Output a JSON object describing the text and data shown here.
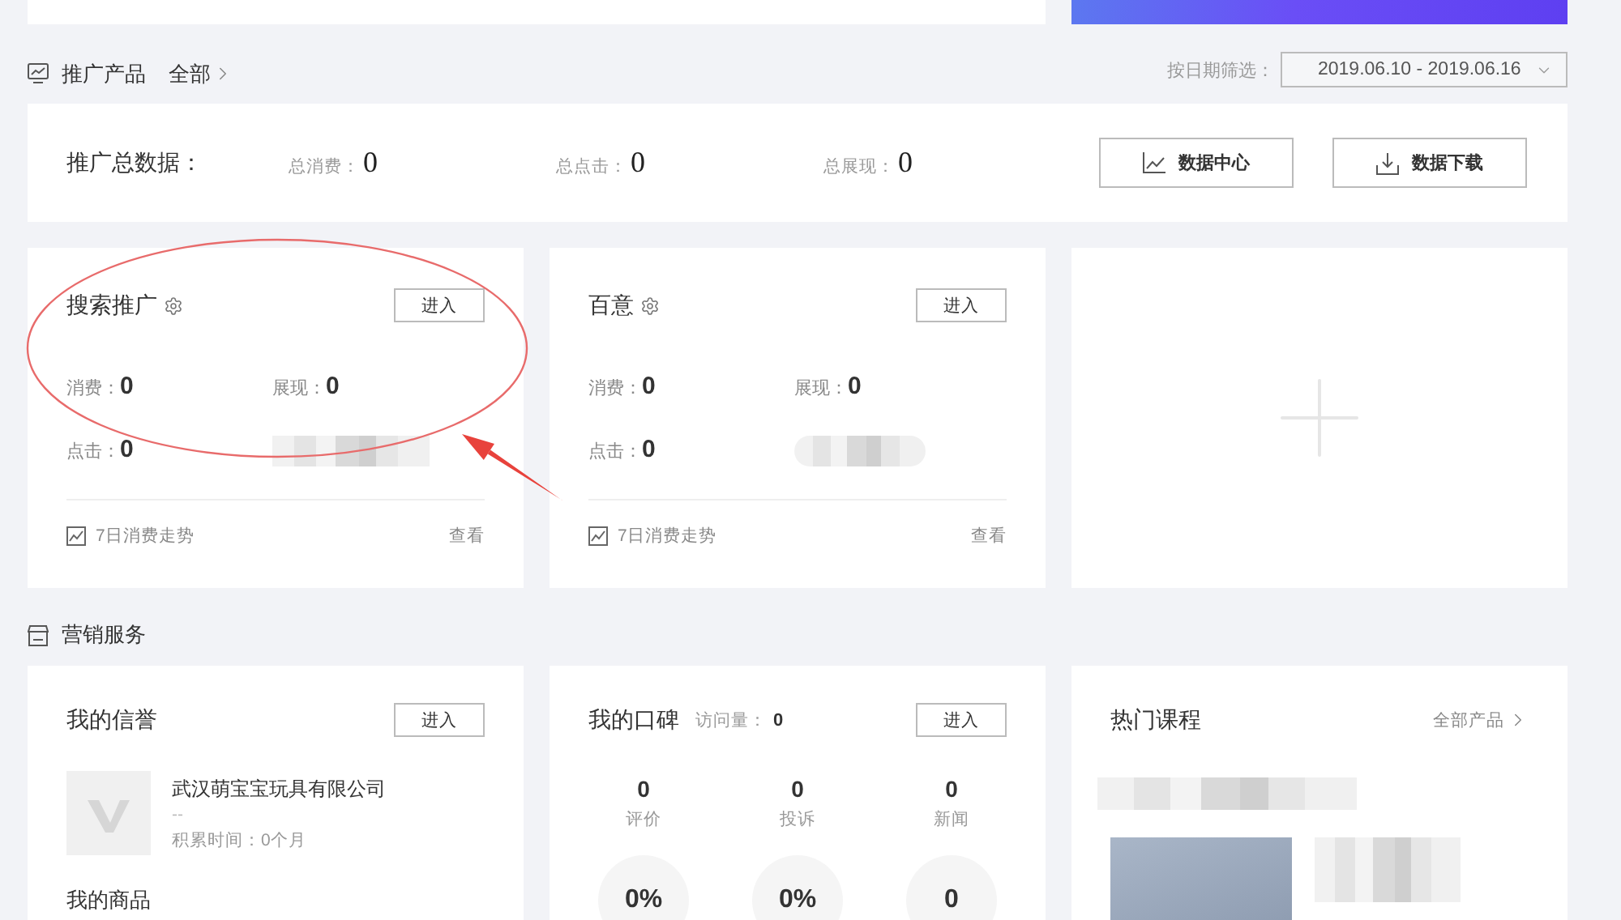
{
  "promotion_header": {
    "title": "推广产品",
    "all_link": "全部",
    "date_filter_label": "按日期筛选：",
    "date_range": "2019.06.10 - 2019.06.16"
  },
  "summary": {
    "title": "推广总数据：",
    "stats": [
      {
        "label": "总消费：",
        "value": "0"
      },
      {
        "label": "总点击：",
        "value": "0"
      },
      {
        "label": "总展现：",
        "value": "0"
      }
    ],
    "buttons": [
      {
        "kind": "chart",
        "label": "数据中心"
      },
      {
        "kind": "download",
        "label": "数据下载"
      }
    ]
  },
  "product_cards": [
    {
      "kind": "product",
      "title": "搜索推广",
      "button": "进入",
      "metrics": [
        {
          "label": "消费：",
          "value": "0"
        },
        {
          "label": "展现：",
          "value": "0"
        },
        {
          "label": "点击：",
          "value": "0"
        }
      ],
      "trend_label": "7日消费走势",
      "view_link": "查看"
    },
    {
      "kind": "product",
      "title": "百意",
      "button": "进入",
      "metrics": [
        {
          "label": "消费：",
          "value": "0"
        },
        {
          "label": "展现：",
          "value": "0"
        },
        {
          "label": "点击：",
          "value": "0"
        }
      ],
      "trend_label": "7日消费走势",
      "view_link": "查看"
    },
    {
      "kind": "add"
    }
  ],
  "marketing_header": {
    "title": "营销服务"
  },
  "reputation": {
    "title": "我的信誉",
    "button": "进入",
    "company": "武汉萌宝宝玩具有限公司",
    "placeholder_line": "--",
    "duration": "积累时间：0个月",
    "goods_heading": "我的商品"
  },
  "word_of_mouth": {
    "title": "我的口碑",
    "visits_label": "访问量：",
    "visits_value": "0",
    "button": "进入",
    "stats": [
      {
        "value": "0",
        "label": "评价"
      },
      {
        "value": "0",
        "label": "投诉"
      },
      {
        "value": "0",
        "label": "新闻"
      }
    ],
    "rates": [
      "0%",
      "0%",
      "0"
    ]
  },
  "courses": {
    "title": "热门课程",
    "all_link": "全部产品"
  }
}
